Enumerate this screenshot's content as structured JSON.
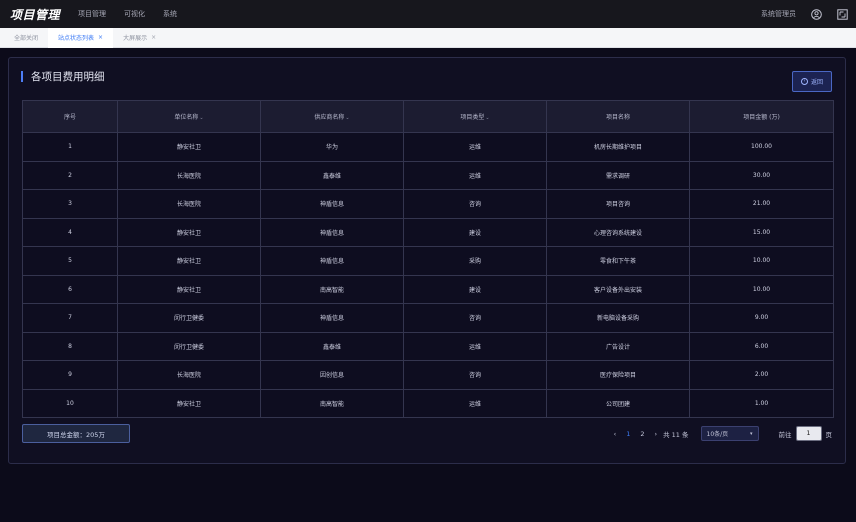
{
  "app": {
    "title": "项目管理",
    "nav": [
      "项目管理",
      "可视化",
      "系统"
    ],
    "user": "系统管理员",
    "icons": {
      "user": "user-circle-icon",
      "fullscreen": "fullscreen-icon"
    }
  },
  "tabs": [
    {
      "label": "全部关闭",
      "closable": false,
      "active": false
    },
    {
      "label": "站点状态列表",
      "closable": true,
      "active": true
    },
    {
      "label": "大屏展示",
      "closable": true,
      "active": false
    }
  ],
  "panel": {
    "title": "各项目费用明细",
    "back_label": "返回"
  },
  "table": {
    "columns": [
      {
        "label": "序号",
        "sortable": false
      },
      {
        "label": "单位名称",
        "sortable": true
      },
      {
        "label": "供应商名称",
        "sortable": true
      },
      {
        "label": "项目类型",
        "sortable": true
      },
      {
        "label": "项目名称",
        "sortable": false
      },
      {
        "label": "项目金额 (万)",
        "sortable": false
      }
    ],
    "rows": [
      [
        "1",
        "静安社卫",
        "华为",
        "运维",
        "机房长期维护项目",
        "100.00"
      ],
      [
        "2",
        "长海医院",
        "鑫泰维",
        "运维",
        "需求调研",
        "30.00"
      ],
      [
        "3",
        "长海医院",
        "神盾信息",
        "咨询",
        "项目咨询",
        "21.00"
      ],
      [
        "4",
        "静安社卫",
        "神盾信息",
        "建设",
        "心理咨询系统建设",
        "15.00"
      ],
      [
        "5",
        "静安社卫",
        "神盾信息",
        "采购",
        "零食和下午茶",
        "10.00"
      ],
      [
        "6",
        "静安社卫",
        "南高智能",
        "建设",
        "客户设备外出安装",
        "10.00"
      ],
      [
        "7",
        "闵行卫健委",
        "神盾信息",
        "咨询",
        "新电脑设备采购",
        "9.00"
      ],
      [
        "8",
        "闵行卫健委",
        "鑫泰维",
        "运维",
        "广告设计",
        "6.00"
      ],
      [
        "9",
        "长海医院",
        "因创信息",
        "咨询",
        "医疗保险项目",
        "2.00"
      ],
      [
        "10",
        "静安社卫",
        "南高智能",
        "运维",
        "公司团建",
        "1.00"
      ]
    ]
  },
  "footer": {
    "total": "项目总金额：205万",
    "pager": {
      "prev": "‹",
      "pages": [
        "1",
        "2"
      ],
      "current": "1",
      "next": "›",
      "total_text": "共 11 条",
      "page_size": "10条/页",
      "goto_label": "前往",
      "goto_value": "1",
      "goto_suffix": "页"
    }
  },
  "colors": {
    "background": "#0c0b1a",
    "accent": "#3d7bf5",
    "topbar": "#17171d"
  }
}
